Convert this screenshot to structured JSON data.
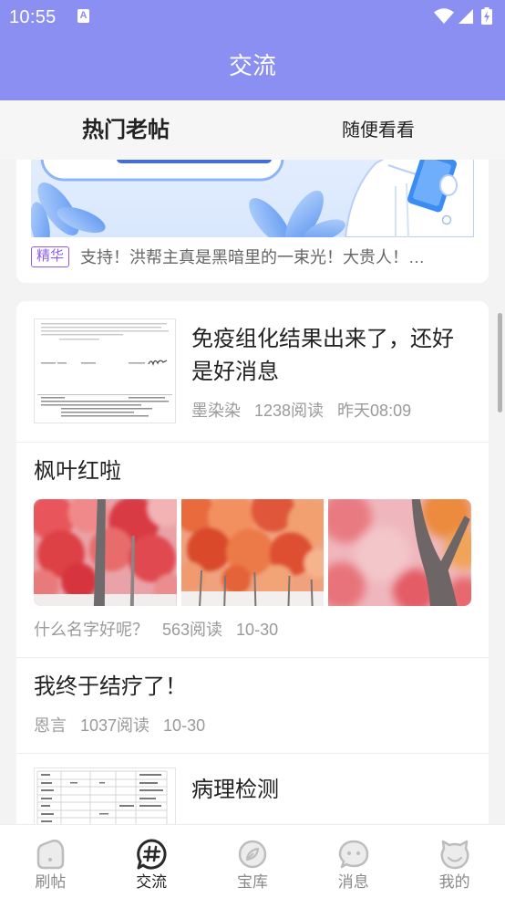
{
  "status_bar": {
    "time": "10:55",
    "notification_letter": "A",
    "icons": [
      "wifi-icon",
      "signal-icon",
      "battery-charging-icon"
    ]
  },
  "header": {
    "title": "交流"
  },
  "tabs": [
    {
      "label": "热门老帖",
      "active": true
    },
    {
      "label": "随便看看",
      "active": false
    }
  ],
  "featured_post": {
    "tag": "精华",
    "excerpt": "支持！洪帮主真是黑暗里的一束光！大贵人！…"
  },
  "posts": [
    {
      "title": "免疫组化结果出来了，还好是好消息",
      "author": "墨染染",
      "reads": "1238阅读",
      "time": "昨天08:09"
    },
    {
      "title": "枫叶红啦",
      "author": "什么名字好呢？",
      "reads": "563阅读",
      "time": "10-30"
    },
    {
      "title": "我终于结疗了！",
      "author": "恩言",
      "reads": "1037阅读",
      "time": "10-30"
    },
    {
      "title": "病理检测"
    }
  ],
  "bottom_nav": [
    {
      "label": "刷帖",
      "icon": "feed-icon",
      "active": false
    },
    {
      "label": "交流",
      "icon": "hashtag-chat-icon",
      "active": true
    },
    {
      "label": "宝库",
      "icon": "compass-icon",
      "active": false
    },
    {
      "label": "消息",
      "icon": "message-bubble-icon",
      "active": false
    },
    {
      "label": "我的",
      "icon": "cat-face-icon",
      "active": false
    }
  ],
  "colors": {
    "primary": "#8a8ff1",
    "tag": "#8e5cf0",
    "nav_active": "#222222",
    "nav_inactive": "#8a8a8a",
    "meta_text": "#9a9a9a"
  }
}
